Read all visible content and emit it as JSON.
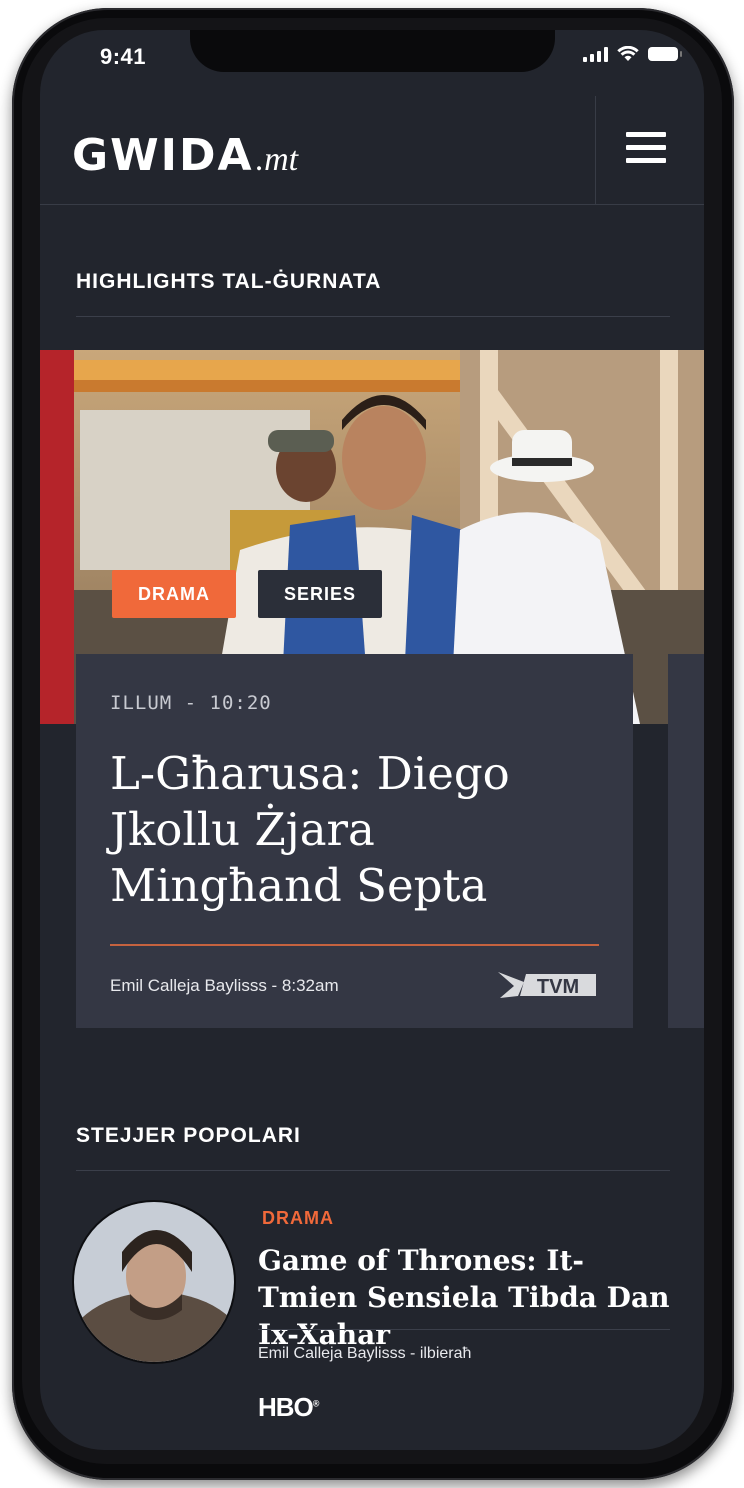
{
  "status_bar": {
    "time": "9:41"
  },
  "header": {
    "logo_main": "GWIDA",
    "logo_tld": ".mt"
  },
  "highlights": {
    "heading": "HIGHLIGHTS TAL-ĠURNATA",
    "card": {
      "tags": [
        "DRAMA",
        "SERIES"
      ],
      "time": "ILLUM - 10:20",
      "title": "L-Għarusa: Diego Jkollu Żjara Mingħand Septa",
      "byline": "Emil Calleja Baylisss - 8:32am",
      "channel": "TVM"
    }
  },
  "popular": {
    "heading": "STEJJER POPOLARI",
    "item": {
      "category": "DRAMA",
      "title": "Game of Thrones: It-Tmien Sensiela Tibda Dan Ix-Xahar",
      "byline": "Emil Calleja Baylisss - ilbieraħ",
      "channel": "HBO"
    }
  },
  "colors": {
    "accent": "#f0693a",
    "background": "#22252d",
    "card": "#343744"
  }
}
